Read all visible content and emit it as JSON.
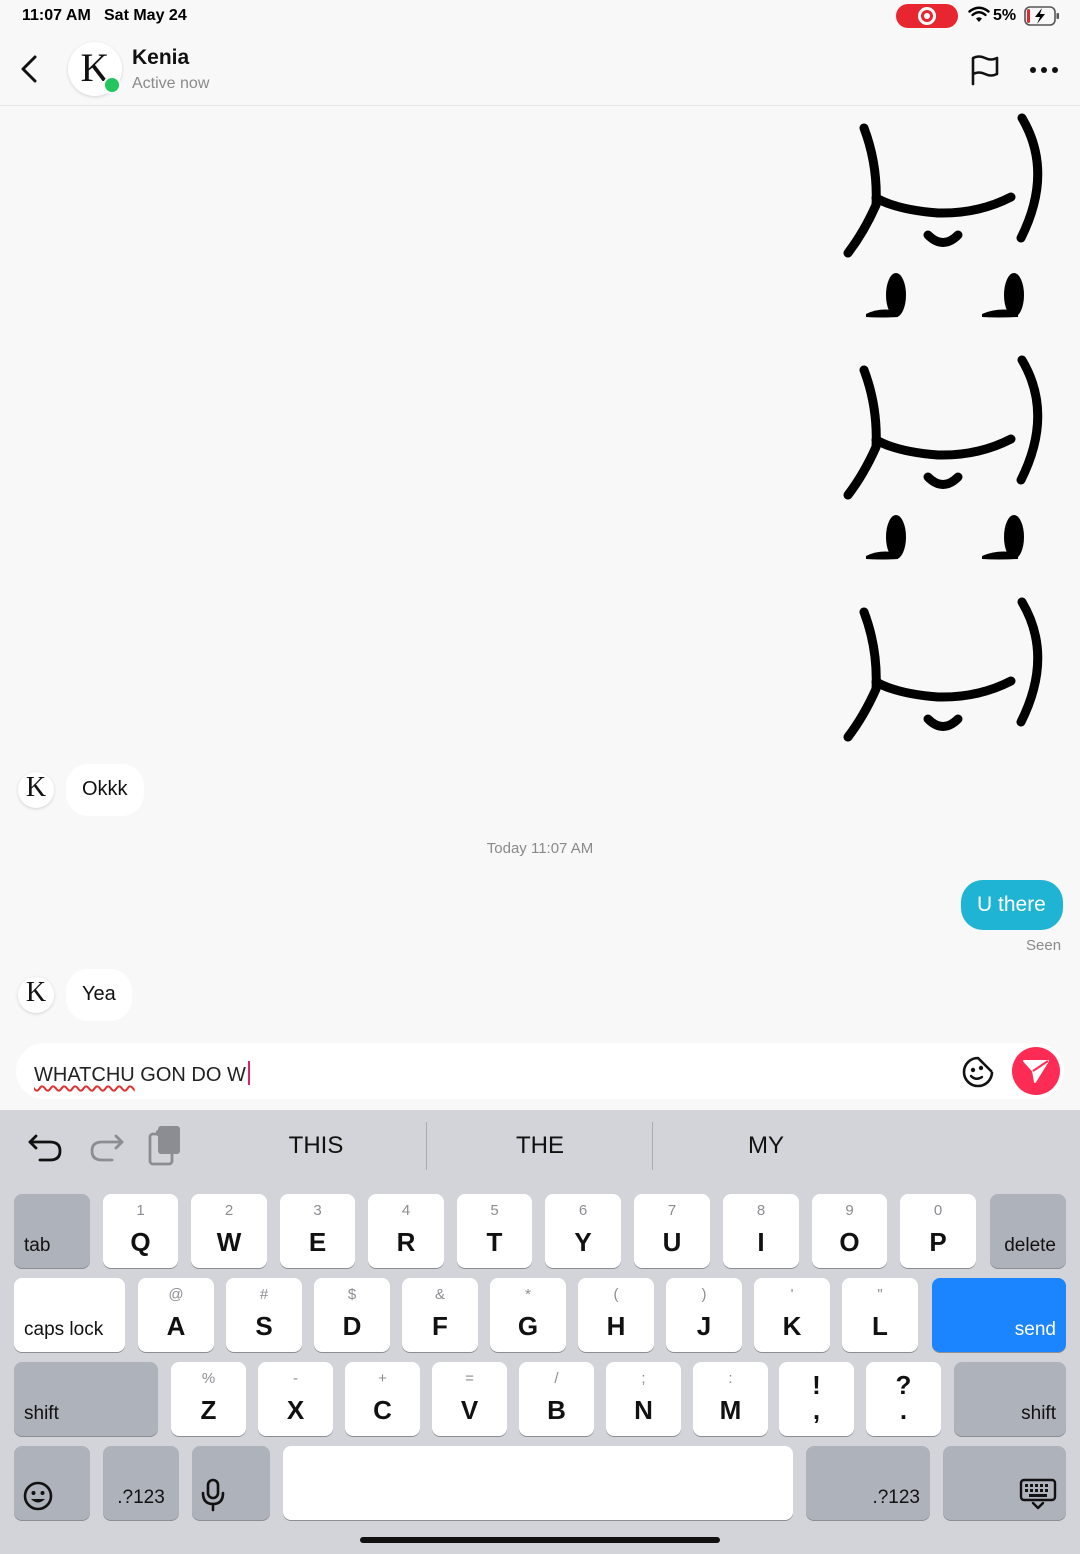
{
  "status_bar": {
    "time": "11:07 AM",
    "date": "Sat May 24",
    "battery": "5%",
    "icons": [
      "screen-record-icon",
      "wifi-icon",
      "battery-charging-icon"
    ],
    "record_color": "#e8262f"
  },
  "header": {
    "avatar_letter": "K",
    "name": "Kenia",
    "status": "Active now",
    "icons": [
      "back-icon",
      "flag-icon",
      "more-icon"
    ]
  },
  "chat": {
    "stickers": [
      "doodle-sticker",
      "doodle-sticker",
      "doodle-sticker"
    ],
    "messages": [
      {
        "from": "contact",
        "avatar": "K",
        "text": "Okkk"
      },
      {
        "type": "timestamp",
        "text": "Today 11:07 AM"
      },
      {
        "from": "me",
        "text": "U there",
        "receipt": "Seen"
      },
      {
        "from": "contact",
        "avatar": "K",
        "text": "Yea"
      }
    ],
    "outgoing_color": "#20b4d4"
  },
  "composer": {
    "first_word": "WHATCHU",
    "rest": " GON DO W",
    "icons": [
      "emoji-icon",
      "send-icon"
    ],
    "send_color": "#fe2c55"
  },
  "keyboard": {
    "tools": [
      "undo-icon",
      "redo-icon",
      "paste-icon"
    ],
    "suggestions": [
      "THIS",
      "THE",
      "MY"
    ],
    "row1": {
      "tab": "tab",
      "keys": [
        {
          "sub": "1",
          "main": "Q"
        },
        {
          "sub": "2",
          "main": "W"
        },
        {
          "sub": "3",
          "main": "E"
        },
        {
          "sub": "4",
          "main": "R"
        },
        {
          "sub": "5",
          "main": "T"
        },
        {
          "sub": "6",
          "main": "Y"
        },
        {
          "sub": "7",
          "main": "U"
        },
        {
          "sub": "8",
          "main": "I"
        },
        {
          "sub": "9",
          "main": "O"
        },
        {
          "sub": "0",
          "main": "P"
        }
      ],
      "delete": "delete"
    },
    "row2": {
      "caps": "caps lock",
      "keys": [
        {
          "sub": "@",
          "main": "A"
        },
        {
          "sub": "#",
          "main": "S"
        },
        {
          "sub": "$",
          "main": "D"
        },
        {
          "sub": "&",
          "main": "F"
        },
        {
          "sub": "*",
          "main": "G"
        },
        {
          "sub": "(",
          "main": "H"
        },
        {
          "sub": ")",
          "main": "J"
        },
        {
          "sub": "'",
          "main": "K"
        },
        {
          "sub": "\"",
          "main": "L"
        }
      ],
      "send": "send"
    },
    "row3": {
      "shift_left": "shift",
      "keys": [
        {
          "sub": "%",
          "main": "Z"
        },
        {
          "sub": "-",
          "main": "X"
        },
        {
          "sub": "+",
          "main": "C"
        },
        {
          "sub": "=",
          "main": "V"
        },
        {
          "sub": "/",
          "main": "B"
        },
        {
          "sub": ";",
          "main": "N"
        },
        {
          "sub": ":",
          "main": "M"
        },
        {
          "sub": "!",
          "main": ","
        },
        {
          "sub": "?",
          "main": "."
        }
      ],
      "shift_right": "shift"
    },
    "row4": {
      "numbers_left": ".?123",
      "numbers_right": ".?123",
      "icons": [
        "emoji-keyboard-icon",
        "microphone-icon",
        "keyboard-dismiss-icon"
      ]
    },
    "send_key_color": "#1b84ff"
  }
}
